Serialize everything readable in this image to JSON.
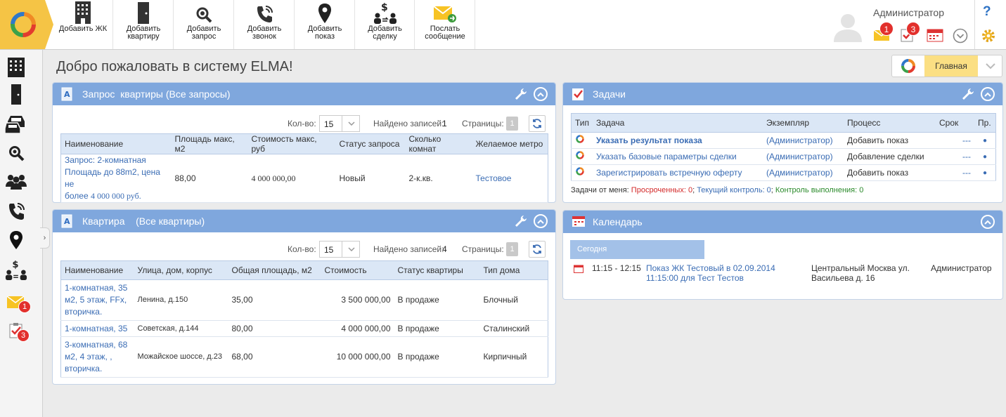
{
  "toolbar": {
    "buttons": [
      {
        "label": "Добавить ЖК"
      },
      {
        "label": "Добавить\nквартиру"
      },
      {
        "label": "Добавить\nзапрос"
      },
      {
        "label": "Добавить\nзвонок"
      },
      {
        "label": "Добавить\nпоказ"
      },
      {
        "label": "Добавить\nсделку"
      },
      {
        "label": "Послать\nсообщение"
      }
    ]
  },
  "header": {
    "user_name": "Администратор",
    "messages_badge": "1",
    "tasks_badge": "3",
    "help": "?"
  },
  "sidebar": {
    "messages_badge": "1",
    "tasks_badge": "3"
  },
  "page": {
    "title": "Добро пожаловать в систему ELMA!",
    "switch_label": "Главная"
  },
  "requests": {
    "title": "Запрос  квартиры (Все запросы)",
    "count_label": "Кол-во:",
    "count_value": "15",
    "found_label": "Найдено записей:",
    "found_value": "1",
    "pages_label": "Страницы:",
    "page_value": "1",
    "columns": [
      "Наименование",
      "Площадь макс, м2",
      "Стоимость макс, руб",
      "Статус запроса",
      "Сколько комнат",
      "Желаемое метро"
    ],
    "row": {
      "name_line1": "Запрос: 2-комнатная",
      "name_line2": "Площадь до 88m2, цена не",
      "name_line3a": "более ",
      "name_line3b": "4 000 000 руб.",
      "area": "88,00",
      "price": "4 000 000,00",
      "status": "Новый",
      "rooms": "2-к.кв.",
      "metro": "Тестовое"
    }
  },
  "flats": {
    "title": "Квартира    (Все квартиры)",
    "count_label": "Кол-во:",
    "count_value": "15",
    "found_label": "Найдено записей:",
    "found_value": "4",
    "pages_label": "Страницы:",
    "page_value": "1",
    "columns": [
      "Наименование",
      "Улица, дом, корпус",
      "Общая площадь, м2",
      "Стоимость",
      "Статус квартиры",
      "Тип дома"
    ],
    "rows": [
      {
        "name": [
          "1-комнатная, 35",
          "м2, 5 этаж, FFx,",
          "вторичка."
        ],
        "street": "Ленина, д.150",
        "area": "35,00",
        "price": "3 500 000,00",
        "status": "В продаже",
        "type": "Блочный"
      },
      {
        "name": [
          "1-комнатная, 35"
        ],
        "street": "Советская, д.144",
        "area": "80,00",
        "price": "4 000 000,00",
        "status": "В продаже",
        "type": "Сталинский"
      },
      {
        "name": [
          "3-комнатная, 68",
          "м2, 4 этаж, ,",
          "вторичка."
        ],
        "street": "Можайское шоссе, д.23",
        "area": "68,00",
        "price": "10 000 000,00",
        "status": "В продаже",
        "type": "Кирпичный"
      }
    ]
  },
  "tasks": {
    "title": "Задачи",
    "columns": [
      "Тип",
      "Задача",
      "Экземпляр",
      "Процесс",
      "Срок",
      "Пр."
    ],
    "rows": [
      {
        "task": "Указать результат показа",
        "instance": "(Администратор)",
        "process": "Добавить показ",
        "due": "---",
        "pr": "●"
      },
      {
        "task": "Указать базовые параметры сделки",
        "instance": "(Администратор)",
        "process": "Добавление сделки",
        "due": "---",
        "pr": "●"
      },
      {
        "task": "Зарегистрировать встречную оферту",
        "instance": "(Администратор)",
        "process": "Добавить показ",
        "due": "---",
        "pr": "●"
      }
    ],
    "footer": {
      "prefix": "Задачи от меня: ",
      "overdue": "Просроченных: 0",
      "sep1": "; ",
      "current": "Текущий контроль: 0",
      "sep2": "; ",
      "control": "Контроль выполнения: 0"
    }
  },
  "calendar": {
    "title": "Календарь",
    "today": "Сегодня",
    "event": {
      "time": "11:15 - 12:15",
      "title_line1": "Показ ЖК Тестовый в 02.09.2014",
      "title_line2": "11:15:00 для Тест Тестов",
      "place_line1": "Центральный Москва ул.",
      "place_line2": "Васильева д. 16",
      "owner": "Администратор"
    }
  }
}
